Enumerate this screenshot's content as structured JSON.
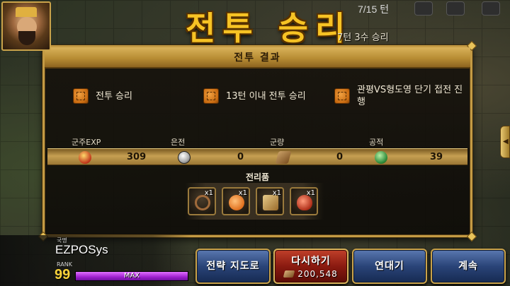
{
  "hud": {
    "turn": "7/15 턴"
  },
  "title": "전투 승리",
  "subtitle": "7턴 3수 승리",
  "panel": {
    "header": "전투 결과",
    "conditions": [
      {
        "text": "전투 승리"
      },
      {
        "text": "13턴 이내 전투 승리"
      },
      {
        "text": "관평VS형도영 단기 접전 진행"
      }
    ],
    "rewards": {
      "exp_label": "군주EXP",
      "exp_value": "309",
      "silver_label": "은전",
      "silver_value": "0",
      "food_label": "군량",
      "food_value": "0",
      "merit_label": "공적",
      "merit_value": "39"
    },
    "loot_title": "전리품",
    "loot": [
      {
        "icon": "rope-icon",
        "qty": "x1"
      },
      {
        "icon": "peach-icon",
        "qty": "x1"
      },
      {
        "icon": "scroll-bundle-icon",
        "qty": "x1"
      },
      {
        "icon": "gourd-icon",
        "qty": "x1"
      }
    ]
  },
  "player": {
    "country_label": "국명",
    "name": "EZPOSys",
    "rank_label": "RANK",
    "rank": "99",
    "xp_text": "MAX",
    "xp_fraction": 1.0
  },
  "buttons": {
    "strategy_map": "전략 지도로",
    "retry": "다시하기",
    "retry_cost": "200,548",
    "chronicle": "연대기",
    "continue": "계속"
  },
  "colors": {
    "title": "#f7c324",
    "panel_border": "#c39a44",
    "xp_bar": "#a020d0"
  }
}
